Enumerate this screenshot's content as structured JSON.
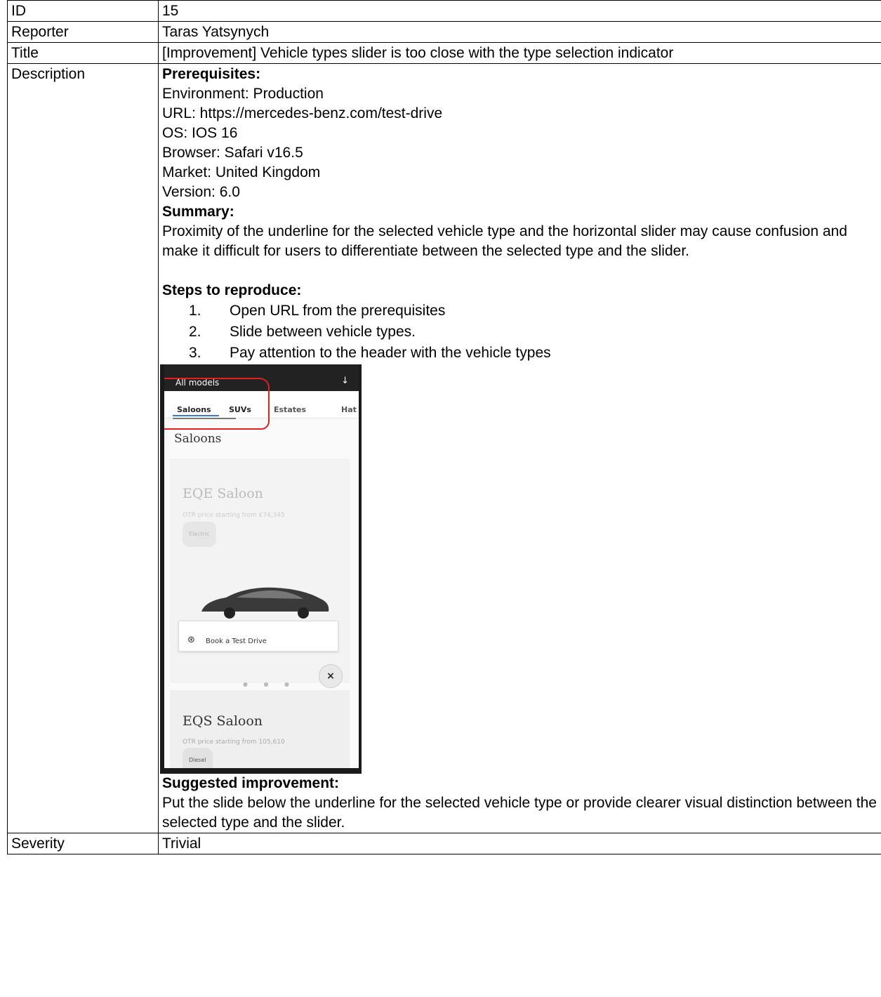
{
  "rows": {
    "id": {
      "label": "ID",
      "value": "15"
    },
    "reporter": {
      "label": "Reporter",
      "value": "Taras Yatsynych"
    },
    "title": {
      "label": "Title",
      "value": "[Improvement] Vehicle types slider is too close with the type selection indicator"
    },
    "severity": {
      "label": "Severity",
      "value": "Trivial"
    }
  },
  "description": {
    "label": "Description",
    "prerequisites_heading": "Prerequisites:",
    "prerequisites": [
      "Environment: Production",
      "URL: https://mercedes-benz.com/test-drive",
      "OS: IOS 16",
      "Browser: Safari v16.5",
      "Market: United Kingdom",
      "Version: 6.0"
    ],
    "summary_heading": "Summary:",
    "summary": "Proximity of the underline for the selected vehicle type and the horizontal slider may cause confusion and make it difficult for users to differentiate between the selected type and the slider.",
    "steps_heading": "Steps to reproduce:",
    "steps": [
      {
        "num": "1.",
        "text": "Open URL from the prerequisites"
      },
      {
        "num": "2.",
        "text": "Slide between vehicle types."
      },
      {
        "num": "3.",
        "text": "Pay attention to the header with the vehicle types"
      }
    ],
    "improvement_heading": "Suggested improvement:",
    "improvement": "Put the slide below the underline for the selected vehicle type or provide clearer visual distinction between the selected type and the slider."
  },
  "screenshot": {
    "header_title": "All models",
    "header_arrow": "↓",
    "tabs": [
      "Saloons",
      "SUVs",
      "Estates",
      "Hat"
    ],
    "section_title": "Saloons",
    "card1": {
      "name": "EQE Saloon",
      "price": "OTR price starting from £74,345",
      "fuel": "Electric"
    },
    "test_drive_label": "Book a Test Drive",
    "card2": {
      "name": "EQS Saloon",
      "price": "OTR price starting from 105,610",
      "fuel": "Diesel"
    },
    "dots": "● ● ●",
    "close": "×",
    "wheel": "⊛"
  },
  "colors": {
    "highlight_red": "#dd2222",
    "selection_blue": "#3a7bd5"
  }
}
